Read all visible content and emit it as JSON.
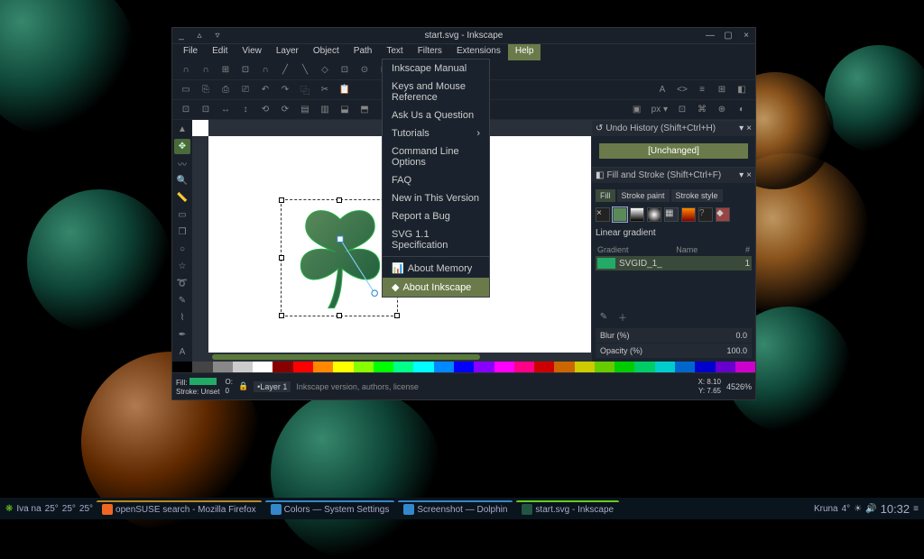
{
  "window": {
    "title": "start.svg - Inkscape",
    "min": "_",
    "max": "□",
    "close": "×"
  },
  "menu": [
    "File",
    "Edit",
    "View",
    "Layer",
    "Object",
    "Path",
    "Text",
    "Filters",
    "Extensions",
    "Help"
  ],
  "help_menu": {
    "items": [
      "Inkscape Manual",
      "Keys and Mouse Reference",
      "Ask Us a Question",
      "Tutorials",
      "Command Line Options",
      "FAQ",
      "New in This Version",
      "Report a Bug",
      "SVG 1.1 Specification"
    ],
    "about_memory": "About Memory",
    "about_inkscape": "About Inkscape"
  },
  "panels": {
    "undo": {
      "title": "Undo History (Shift+Ctrl+H)",
      "item": "[Unchanged]"
    },
    "fill": {
      "title": "Fill and Stroke (Shift+Ctrl+F)",
      "tabs": [
        "Fill",
        "Stroke paint",
        "Stroke style"
      ],
      "linear": "Linear gradient",
      "col_gradient": "Gradient",
      "col_name": "Name",
      "col_count": "#",
      "grad_name": "SVGID_1_",
      "grad_count": "1",
      "blur": "Blur (%)",
      "blur_val": "0.0",
      "opacity": "Opacity (%)",
      "opacity_val": "100.0"
    }
  },
  "status": {
    "fill": "Fill:",
    "stroke": "Stroke:",
    "stroke_val": "Unset",
    "o": "O:",
    "o_val": "0",
    "layer": "•Layer 1",
    "hint": "Inkscape version, authors, license",
    "x": "X:",
    "x_val": "8.10",
    "y": "Y:",
    "y_val": "7.65",
    "zoom": "4526%"
  },
  "taskbar": {
    "user": "Iva   na",
    "temp1": "25°",
    "temp2": "25°",
    "temp3": "25°",
    "app1": "openSUSE search - Mozilla Firefox",
    "app2": "Colors — System Settings",
    "app3": "Screenshot — Dolphin",
    "app4": "start.svg - Inkscape",
    "city": "Kruna",
    "temp": "4°",
    "time": "10:32"
  },
  "palette": [
    "#000",
    "#444",
    "#888",
    "#ccc",
    "#fff",
    "#800",
    "#f00",
    "#f80",
    "#ff0",
    "#8f0",
    "#0f0",
    "#0f8",
    "#0ff",
    "#08f",
    "#00f",
    "#80f",
    "#f0f",
    "#f08",
    "#c00",
    "#c60",
    "#cc0",
    "#6c0",
    "#0c0",
    "#0c6",
    "#0cc",
    "#06c",
    "#00c",
    "#60c",
    "#c0c"
  ]
}
